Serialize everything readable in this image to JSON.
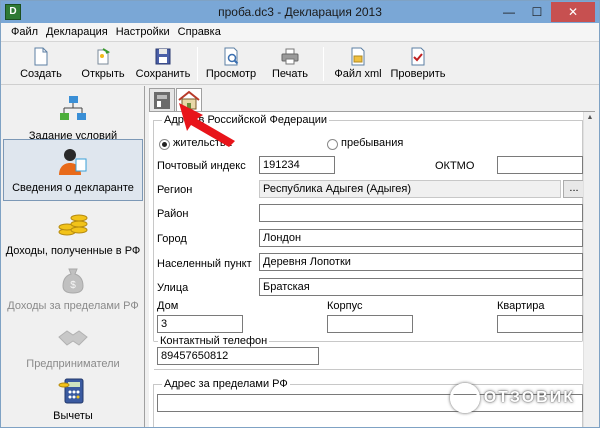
{
  "window": {
    "title": "проба.dc3 - Декларация 2013",
    "app_icon": "D",
    "controls": {
      "minimize": "—",
      "maximize": "☐",
      "close": "✕"
    }
  },
  "menu": [
    "Файл",
    "Декларация",
    "Настройки",
    "Справка"
  ],
  "toolbar": {
    "create": "Создать",
    "open": "Открыть",
    "save": "Сохранить",
    "preview": "Просмотр",
    "print": "Печать",
    "xml_file": "Файл xml",
    "check": "Проверить"
  },
  "nav": {
    "conditions": "Задание условий",
    "declarant": "Сведения о декларанте",
    "income_rf": "Доходы, полученные в РФ",
    "income_abroad": "Доходы за пределами РФ",
    "entrepreneurs": "Предприниматели",
    "deductions": "Вычеты"
  },
  "tabs": {
    "first": "person-id-tab-icon",
    "second": "house-tab-icon"
  },
  "address_rf": {
    "title": "Адрес в Российской Федерации",
    "radio_residence": "жительства",
    "radio_stay": "пребывания",
    "postal_code_label": "Почтовый индекс",
    "postal_code": "191234",
    "oktmo_label": "ОКТМО",
    "oktmo": "",
    "region_label": "Регион",
    "region": "Республика Адыгея (Адыгея)",
    "region_button": "...",
    "district_label": "Район",
    "district": "",
    "city_label": "Город",
    "city": "Лондон",
    "locality_label": "Населенный пункт",
    "locality": "Деревня Лопотки",
    "street_label": "Улица",
    "street": "Братская",
    "house_label": "Дом",
    "house": "3",
    "building_label": "Корпус",
    "building": "",
    "apartment_label": "Квартира",
    "apartment": ""
  },
  "contact": {
    "title": "Контактный телефон",
    "phone": "89457650812"
  },
  "address_abroad": {
    "title": "Адрес за пределами РФ",
    "value": ""
  },
  "watermark": "ОТЗОВИК",
  "colors": {
    "titlebar": "#7aa7d6",
    "close": "#c75050",
    "arrow": "#e8141a"
  }
}
